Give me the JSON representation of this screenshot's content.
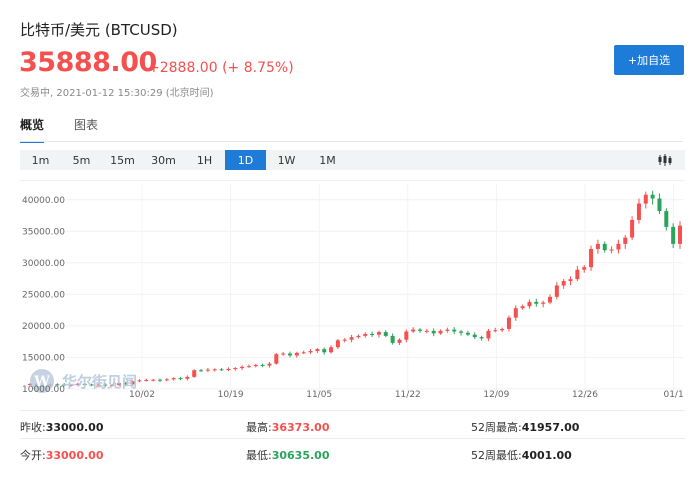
{
  "header": {
    "title": "比特币/美元 (BTCUSD)",
    "price": "35888.00",
    "change": "+2888.00 (+ 8.75%)",
    "status": "交易中, 2021-01-12 15:30:29 (北京时间)",
    "add_button": "+加自选"
  },
  "tabs": [
    "概览",
    "图表"
  ],
  "periods": {
    "items": [
      "1m",
      "5m",
      "15m",
      "30m",
      "1H",
      "1D",
      "1W",
      "1M"
    ],
    "selected": "1D",
    "chart_type_icon": "candlestick-icon"
  },
  "watermark": "华尔街见闻",
  "stats": {
    "prev_close_label": "昨收:",
    "prev_close": "33000.00",
    "high_label": "最高:",
    "high": "36373.00",
    "high52_label": "52周最高:",
    "high52": "41957.00",
    "open_label": "今开:",
    "open": "33000.00",
    "low_label": "最低:",
    "low": "30635.00",
    "low52_label": "52周最低:",
    "low52": "4001.00"
  },
  "colors": {
    "up": "#f4504f",
    "down": "#2aa45a",
    "accent": "#1f7bd8"
  },
  "chart_data": {
    "type": "candlestick",
    "x_ticks": [
      "10/02",
      "10/19",
      "11/05",
      "11/22",
      "12/09",
      "12/26",
      "01/1"
    ],
    "y_ticks": [
      "10000.00",
      "15000.00",
      "20000.00",
      "25000.00",
      "30000.00",
      "35000.00",
      "40000.00"
    ],
    "ylim": [
      9500,
      42500
    ],
    "closes": [
      10780,
      10620,
      10550,
      10720,
      10690,
      10580,
      10650,
      10800,
      10700,
      10600,
      10680,
      10550,
      10630,
      10900,
      10750,
      11200,
      11350,
      11400,
      11450,
      11350,
      11500,
      11700,
      11600,
      11900,
      12950,
      12900,
      13050,
      13100,
      13000,
      13150,
      13300,
      13500,
      13600,
      13800,
      13700,
      14000,
      15500,
      15600,
      15300,
      15700,
      15800,
      16000,
      16300,
      15800,
      16600,
      17700,
      17800,
      18200,
      18400,
      18700,
      18600,
      19000,
      18400,
      17300,
      17800,
      19100,
      19400,
      19200,
      19200,
      18800,
      19200,
      19400,
      19100,
      18900,
      18600,
      18200,
      18000,
      19200,
      19300,
      19500,
      21300,
      22800,
      23100,
      23800,
      23500,
      23700,
      24600,
      26400,
      27100,
      27400,
      28900,
      29300,
      32200,
      33000,
      32000,
      32100,
      33000,
      34000,
      36800,
      39400,
      40800,
      40200,
      38200,
      35700,
      33000,
      35888
    ]
  }
}
